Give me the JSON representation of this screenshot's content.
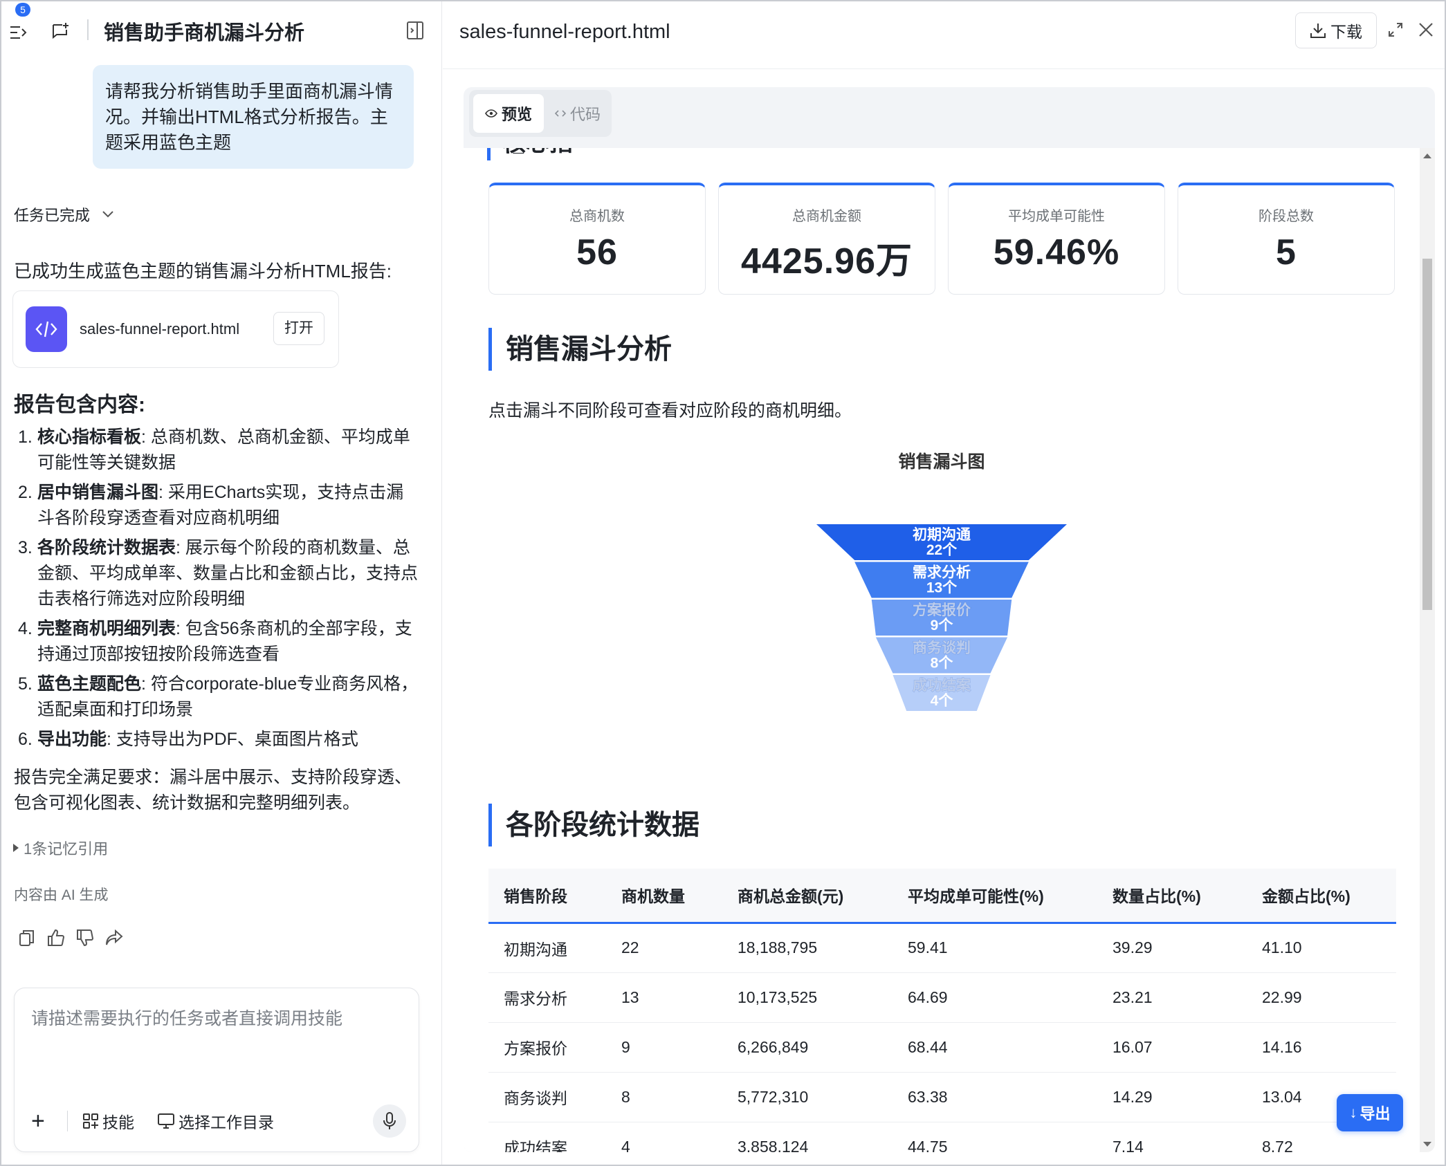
{
  "left": {
    "badge_count": "5",
    "title": "销售助手商机漏斗分析",
    "user_message": "请帮我分析销售助手里面商机漏斗情况。并输出HTML格式分析报告。主题采用蓝色主题",
    "task_status": "任务已完成",
    "intro": "已成功生成蓝色主题的销售漏斗分析HTML报告:",
    "file_card": {
      "name": "sales-funnel-report.html",
      "open_label": "打开"
    },
    "section_title": "报告包含内容:",
    "items": [
      {
        "num": "1.",
        "bold": "核心指标看板",
        "text": ": 总商机数、总商机金额、平均成单可能性等关键数据"
      },
      {
        "num": "2.",
        "bold": "居中销售漏斗图",
        "text": ": 采用ECharts实现，支持点击漏斗各阶段穿透查看对应商机明细"
      },
      {
        "num": "3.",
        "bold": "各阶段统计数据表",
        "text": ": 展示每个阶段的商机数量、总金额、平均成单率、数量占比和金额占比，支持点击表格行筛选对应阶段明细"
      },
      {
        "num": "4.",
        "bold": "完整商机明细列表",
        "text": ": 包含56条商机的全部字段，支持通过顶部按钮按阶段筛选查看"
      },
      {
        "num": "5.",
        "bold": "蓝色主题配色",
        "text": ": 符合corporate-blue专业商务风格，适配桌面和打印场景"
      },
      {
        "num": "6.",
        "bold": "导出功能",
        "text": ": 支持导出为PDF、桌面图片格式"
      }
    ],
    "summary": "报告完全满足要求：漏斗居中展示、支持阶段穿透、包含可视化图表、统计数据和完整明细列表。",
    "memory_ref": "1条记忆引用",
    "ai_generated": "内容由 AI 生成",
    "input": {
      "placeholder": "请描述需要执行的任务或者直接调用技能",
      "skills_label": "技能",
      "workdir_label": "选择工作目录"
    }
  },
  "right": {
    "filename": "sales-funnel-report.html",
    "download_label": "下载",
    "tab_preview": "预览",
    "tab_code": "代码",
    "prev_heading_partial": "核心指标",
    "kpis": [
      {
        "label": "总商机数",
        "value": "56"
      },
      {
        "label": "总商机金额",
        "value": "4425.96万"
      },
      {
        "label": "平均成单可能性",
        "value": "59.46%"
      },
      {
        "label": "阶段总数",
        "value": "5"
      }
    ],
    "funnel_section_title": "销售漏斗分析",
    "funnel_note": "点击漏斗不同阶段可查看对应阶段的商机明细。",
    "funnel_chart_title": "销售漏斗图",
    "stats_section_title": "各阶段统计数据",
    "export_label": "导出"
  },
  "chart_data": {
    "type": "funnel",
    "title": "销售漏斗图",
    "categories": [
      "初期沟通",
      "需求分析",
      "方案报价",
      "商务谈判",
      "成功结案"
    ],
    "values": [
      22,
      13,
      9,
      8,
      4
    ],
    "value_labels": [
      "22个",
      "13个",
      "9个",
      "8个",
      "4个"
    ],
    "colors": [
      "#1f5fe8",
      "#3f7df0",
      "#6b9cf4",
      "#93b7f7",
      "#b6cef9"
    ]
  },
  "table": {
    "headers": [
      "销售阶段",
      "商机数量",
      "商机总金额(元)",
      "平均成单可能性(%)",
      "数量占比(%)",
      "金额占比(%)"
    ],
    "rows": [
      [
        "初期沟通",
        "22",
        "18,188,795",
        "59.41",
        "39.29",
        "41.10"
      ],
      [
        "需求分析",
        "13",
        "10,173,525",
        "64.69",
        "23.21",
        "22.99"
      ],
      [
        "方案报价",
        "9",
        "6,266,849",
        "68.44",
        "16.07",
        "14.16"
      ],
      [
        "商务谈判",
        "8",
        "5,772,310",
        "63.38",
        "14.29",
        "13.04"
      ],
      [
        "成功结案",
        "4",
        "3,858,124",
        "44.75",
        "7.14",
        "8.72"
      ]
    ]
  }
}
